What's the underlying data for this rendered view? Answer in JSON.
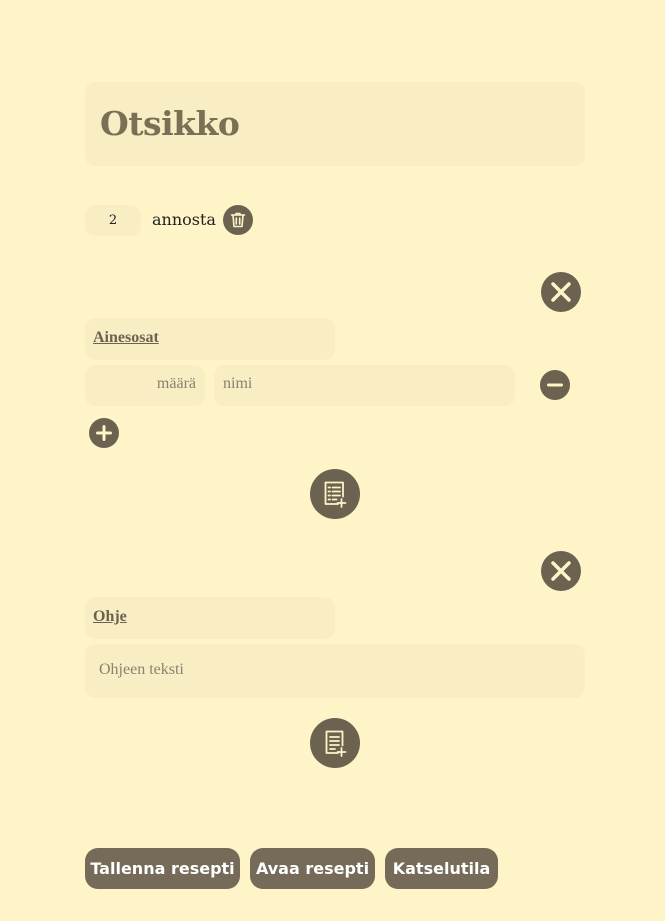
{
  "recipe": {
    "title": "Otsikko",
    "servings_value": "2",
    "servings_label": "annosta"
  },
  "ingredients_section": {
    "heading": "Ainesosat",
    "amount_placeholder": "määrä",
    "name_placeholder": "nimi"
  },
  "instructions_section": {
    "heading": "Ohje",
    "text_placeholder": "Ohjeen teksti"
  },
  "footer": {
    "save_label": "Tallenna resepti",
    "open_label": "Avaa resepti",
    "view_label": "Katselutila"
  },
  "colors": {
    "background": "#FFF3C8",
    "field": "#F9EDC3",
    "icon": "#6b6350",
    "button": "#756B58"
  }
}
